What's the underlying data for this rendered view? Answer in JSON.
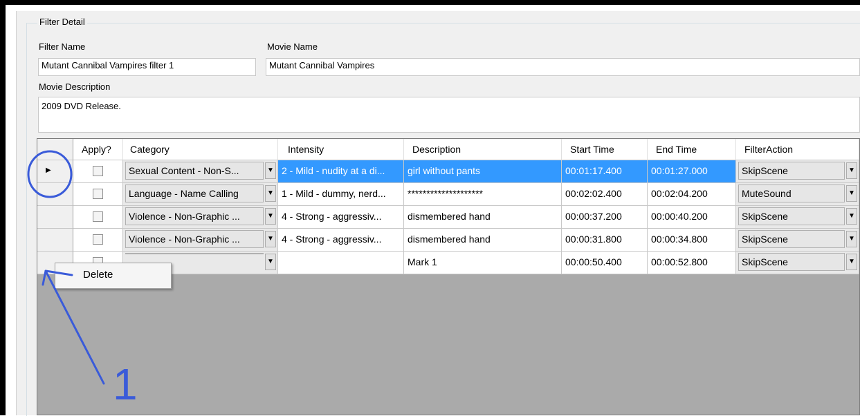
{
  "filter_detail": {
    "group_title": "Filter Detail",
    "filter_name_label": "Filter Name",
    "filter_name_value": "Mutant Cannibal Vampires filter 1",
    "movie_name_label": "Movie Name",
    "movie_name_value": "Mutant Cannibal Vampires",
    "movie_description_label": "Movie Description",
    "movie_description_value": "2009 DVD Release."
  },
  "grid": {
    "headers": {
      "apply": "Apply?",
      "category": "Category",
      "intensity": "Intensity",
      "description": "Description",
      "start_time": "Start Time",
      "end_time": "End Time",
      "filter_action": "FilterAction"
    },
    "rows": [
      {
        "category": "Sexual Content - Non-S...",
        "intensity": "2 - Mild - nudity at a di...",
        "description": "girl without pants",
        "start": "00:01:17.400",
        "end": "00:01:27.000",
        "action": "SkipScene"
      },
      {
        "category": "Language - Name Calling",
        "intensity": "1 - Mild - dummy, nerd...",
        "description": "********************",
        "start": "00:02:02.400",
        "end": "00:02:04.200",
        "action": "MuteSound"
      },
      {
        "category": "Violence - Non-Graphic ...",
        "intensity": "4 - Strong - aggressiv...",
        "description": "dismembered hand",
        "start": "00:00:37.200",
        "end": "00:00:40.200",
        "action": "SkipScene"
      },
      {
        "category": "Violence - Non-Graphic ...",
        "intensity": "4 - Strong - aggressiv...",
        "description": "dismembered hand",
        "start": "00:00:31.800",
        "end": "00:00:34.800",
        "action": "SkipScene"
      },
      {
        "category": "",
        "intensity": "",
        "description": "Mark 1",
        "start": "00:00:50.400",
        "end": "00:00:52.800",
        "action": "SkipScene"
      }
    ]
  },
  "context_menu": {
    "delete_label": "Delete"
  },
  "annotation": {
    "number_label": "1",
    "color": "#3a5bd9"
  },
  "colors": {
    "selection": "#3399ff",
    "grid_background": "#aaaaaa"
  },
  "icons": {
    "row_pointer": "row-pointer-icon",
    "dropdown": "chevron-down-icon"
  }
}
